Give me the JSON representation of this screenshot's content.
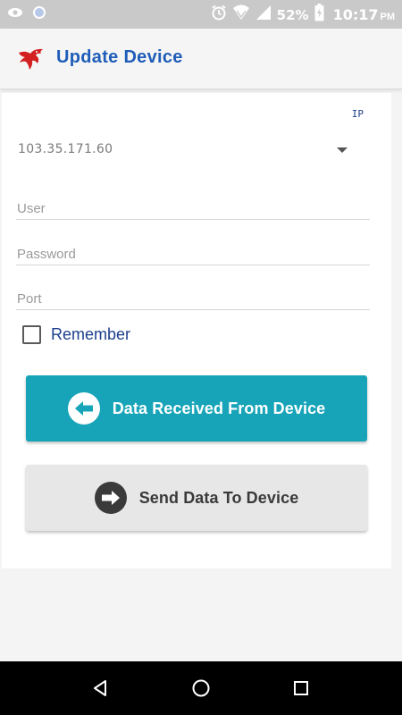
{
  "status_bar": {
    "battery": "52%",
    "time": "10:17",
    "ampm": "PM",
    "icons": [
      "eye-icon",
      "circle-dot-icon",
      "alarm-icon",
      "wifi-icon",
      "signal-icon",
      "battery-charging-icon"
    ]
  },
  "app_bar": {
    "title": "Update Device",
    "logo": "eagle-logo"
  },
  "form": {
    "ip_label": "IP",
    "ip_value": "103.35.171.60",
    "user_placeholder": "User",
    "password_placeholder": "Password",
    "port_placeholder": "Port",
    "remember_label": "Remember",
    "remember_checked": false
  },
  "buttons": {
    "received_label": "Data Received From Device",
    "send_label": "Send Data To Device"
  },
  "colors": {
    "accent": "#17a4b8",
    "title": "#1f5db8",
    "logo": "#d32020"
  },
  "nav_bar": {
    "icons": [
      "back-icon",
      "home-icon",
      "recents-icon"
    ]
  }
}
